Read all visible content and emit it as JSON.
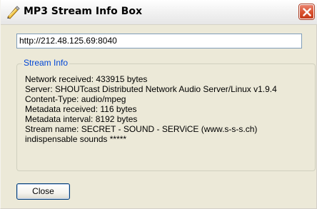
{
  "window": {
    "title": "MP3 Stream Info Box",
    "icon": "mp3-stream-icon",
    "close_icon": "close-icon"
  },
  "url_field": {
    "value": "http://212.48.125.69:8040"
  },
  "stream_info": {
    "legend": "Stream Info",
    "lines": [
      "Network received: 433915 bytes",
      "Server: SHOUTcast Distributed Network Audio Server/Linux v1.9.4",
      "Content-Type: audio/mpeg",
      "Metadata received: 116 bytes",
      "Metadata interval: 8192 bytes",
      "Stream name: SECRET - SOUND - SERViCE (www.s-s-s.ch)",
      "indispensable sounds *****"
    ]
  },
  "buttons": {
    "close_label": "Close"
  },
  "colors": {
    "dialog_background": "#ece9d8",
    "legend_text": "#0046d5",
    "close_button_red": "#d9512f",
    "field_border": "#7f9db9"
  }
}
